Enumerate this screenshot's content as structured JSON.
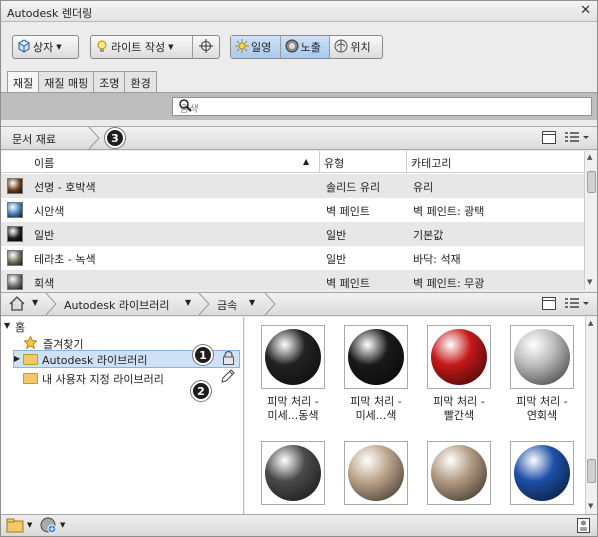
{
  "window": {
    "title": "Autodesk 렌더링",
    "close": "✕"
  },
  "toolbar": {
    "box_label": "상자",
    "light_label": "라이트 작성",
    "sun_label": "일영",
    "exposure_label": "노출",
    "location_label": "위치"
  },
  "tabs": [
    {
      "label": "재질",
      "active": true
    },
    {
      "label": "재질 매핑",
      "active": false
    },
    {
      "label": "조명",
      "active": false
    },
    {
      "label": "환경",
      "active": false
    }
  ],
  "search": {
    "placeholder": "검색"
  },
  "doc_breadcrumb": {
    "label": "문서 재료",
    "callout": "3"
  },
  "table": {
    "columns": [
      "이름",
      "유형",
      "카테고리"
    ],
    "rows": [
      {
        "name": "선명 - 호박색",
        "type": "솔리드 유리",
        "category": "유리",
        "swatch": "#6a3a1a"
      },
      {
        "name": "시안색",
        "type": "벽 페인트",
        "category": "벽 페인트: 광택",
        "swatch": "#3d78b5"
      },
      {
        "name": "일반",
        "type": "일반",
        "category": "기본값",
        "swatch": "#1a1a1a"
      },
      {
        "name": "테라초 - 녹색",
        "type": "일반",
        "category": "바닥: 석재",
        "swatch": "#5f6e53"
      },
      {
        "name": "회색",
        "type": "벽 페인트",
        "category": "벽 페인트: 무광",
        "swatch": "#6a6a6a"
      }
    ]
  },
  "lib_breadcrumb": {
    "items": [
      "Autodesk 라이브러리",
      "금속"
    ]
  },
  "tree": {
    "home": "홈",
    "favorites": "즐겨찾기",
    "autodesk_lib": "Autodesk 라이브러리",
    "user_lib": "내 사용자 지정 라이브러리",
    "callout1": "1",
    "callout2": "2"
  },
  "materials": [
    {
      "line1": "피막 처리 -",
      "line2": "미세...동색",
      "color": "#222"
    },
    {
      "line1": "피막 처리 -",
      "line2": "미세...색",
      "color": "#1a1a1a"
    },
    {
      "line1": "피막 처리 -",
      "line2": "빨간색",
      "color": "#c41818"
    },
    {
      "line1": "피막 처리 -",
      "line2": "연회색",
      "color": "#bdbdbd"
    },
    {
      "line1": "",
      "line2": "",
      "color": "#4a4a4a"
    },
    {
      "line1": "",
      "line2": "",
      "color": "#bfa68c"
    },
    {
      "line1": "",
      "line2": "",
      "color": "#b39c84"
    },
    {
      "line1": "",
      "line2": "",
      "color": "#1e4fa8"
    }
  ]
}
